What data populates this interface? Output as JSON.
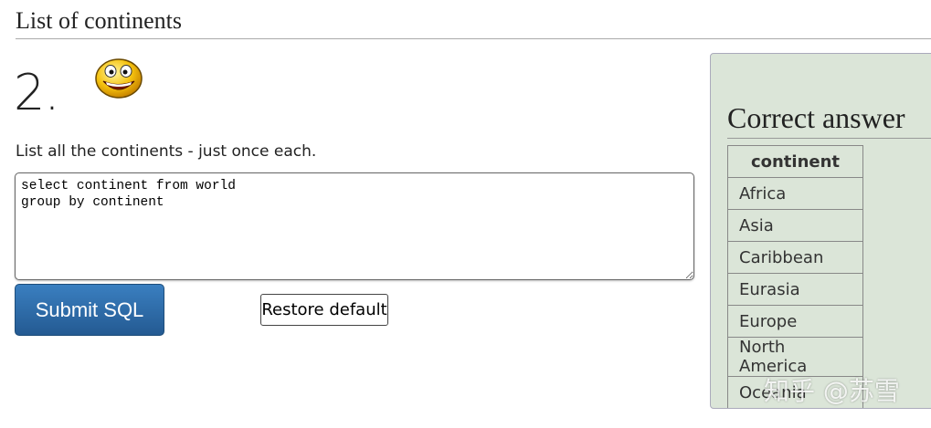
{
  "header": {
    "title": "List of continents"
  },
  "question": {
    "number": "2.",
    "text": "List all the continents - just once each.",
    "sql": "select continent from world\ngroup by continent"
  },
  "buttons": {
    "submit": "Submit SQL",
    "restore": "Restore default"
  },
  "answer": {
    "title": "Correct answer",
    "column": "continent",
    "rows": [
      "Africa",
      "Asia",
      "Caribbean",
      "Eurasia",
      "Europe",
      "North America",
      "Oceania"
    ]
  },
  "watermark": "知乎 @苏雪",
  "colors": {
    "panel_bg": "#dbe5d8",
    "submit_bg": "#2e6da8"
  }
}
